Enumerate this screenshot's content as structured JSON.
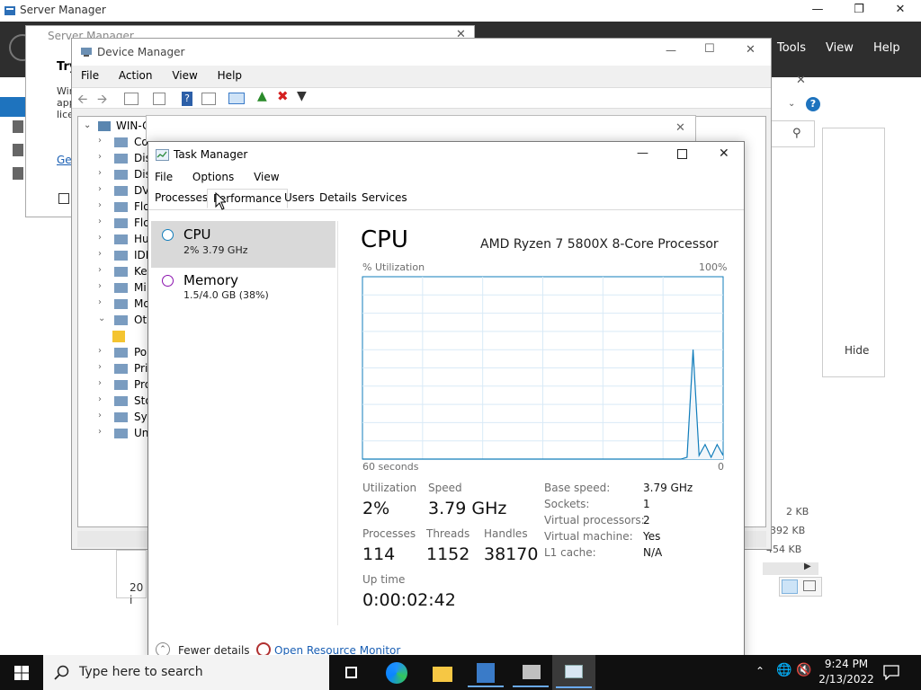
{
  "server_manager": {
    "title": "Server Manager",
    "menu": [
      "Tools",
      "View",
      "Help"
    ],
    "partial_title_text": "Server Manager",
    "right_panel": {
      "hide_label": "Hide"
    },
    "file_sizes": [
      "2 KB",
      "392 KB",
      "454 KB"
    ],
    "partial_text_20": "20 i",
    "dialog_fragments": {
      "heading": "Try",
      "lines": [
        "Wir",
        "app",
        "lice"
      ],
      "link": "Ge"
    }
  },
  "device_manager": {
    "title": "Device Manager",
    "menu": [
      "File",
      "Action",
      "View",
      "Help"
    ],
    "tree_root": "WIN-G",
    "tree_items": [
      "Co",
      "Dis",
      "Dis",
      "DV",
      "Flo",
      "Flo",
      "Hu",
      "IDE",
      "Key",
      "Mi",
      "Mo",
      "Oth",
      "",
      "Po",
      "Pri",
      "Pro",
      "Sto",
      "Sys",
      "Un"
    ]
  },
  "task_manager": {
    "title": "Task Manager",
    "menu": [
      "File",
      "Options",
      "View"
    ],
    "tabs": [
      "Processes",
      "Performance",
      "Users",
      "Details",
      "Services"
    ],
    "active_tab": "Performance",
    "sidebar": [
      {
        "name": "CPU",
        "detail": "2% 3.79 GHz",
        "selected": true,
        "color": "#117dbb"
      },
      {
        "name": "Memory",
        "detail": "1.5/4.0 GB (38%)",
        "selected": false,
        "color": "#8b12ae"
      }
    ],
    "detail": {
      "heading": "CPU",
      "processor": "AMD Ryzen 7 5800X 8-Core Processor",
      "graph_label_left": "% Utilization",
      "graph_label_right": "100%",
      "graph_bottom_left": "60 seconds",
      "graph_bottom_right": "0",
      "stats": {
        "utilization_label": "Utilization",
        "utilization_value": "2%",
        "speed_label": "Speed",
        "speed_value": "3.79 GHz",
        "processes_label": "Processes",
        "processes_value": "114",
        "threads_label": "Threads",
        "threads_value": "1152",
        "handles_label": "Handles",
        "handles_value": "38170",
        "uptime_label": "Up time",
        "uptime_value": "0:00:02:42"
      },
      "specs": [
        {
          "label": "Base speed:",
          "value": "3.79 GHz"
        },
        {
          "label": "Sockets:",
          "value": "1"
        },
        {
          "label": "Virtual processors:",
          "value": "2"
        },
        {
          "label": "Virtual machine:",
          "value": "Yes"
        },
        {
          "label": "L1 cache:",
          "value": "N/A"
        }
      ]
    },
    "footer": {
      "fewer_details": "Fewer details",
      "open_monitor": "Open Resource Monitor"
    },
    "accent": "#117dbb"
  },
  "chart_data": {
    "type": "line",
    "title": "",
    "xlabel": "60 seconds",
    "ylabel": "% Utilization",
    "xlim": [
      60,
      0
    ],
    "ylim": [
      0,
      100
    ],
    "grid": true,
    "series": [
      {
        "values": [
          0,
          0,
          0,
          0,
          0,
          0,
          0,
          0,
          0,
          0,
          0,
          0,
          0,
          0,
          0,
          0,
          0,
          0,
          0,
          0,
          0,
          0,
          0,
          0,
          0,
          0,
          0,
          0,
          0,
          0,
          0,
          0,
          0,
          0,
          0,
          0,
          0,
          0,
          0,
          0,
          0,
          0,
          0,
          0,
          0,
          0,
          0,
          0,
          0,
          0,
          0,
          0,
          0,
          0,
          1,
          60,
          2,
          8,
          1,
          8,
          2
        ]
      }
    ]
  },
  "taskbar": {
    "search_placeholder": "Type here to search",
    "time": "9:24 PM",
    "date": "2/13/2022",
    "icons": [
      "task-view-icon",
      "edge-icon",
      "file-explorer-icon",
      "server-manager-icon",
      "device-manager-icon",
      "task-manager-icon"
    ]
  }
}
